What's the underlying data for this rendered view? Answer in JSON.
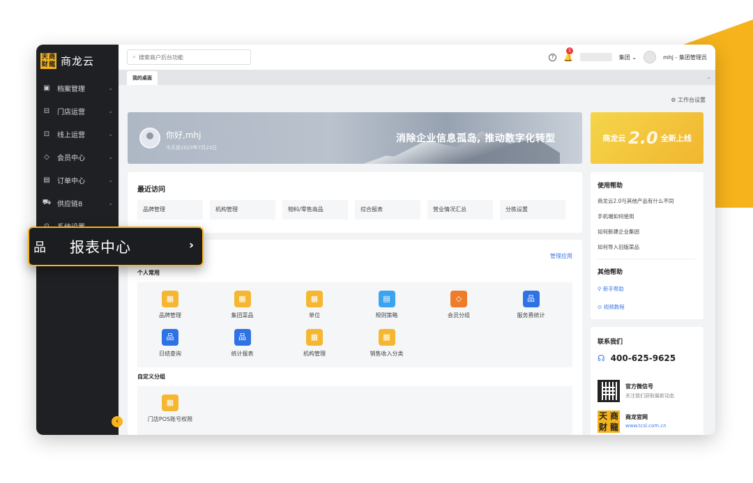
{
  "brand": {
    "logo_chars": [
      "天",
      "商",
      "财",
      "龍"
    ],
    "name": "商龙云"
  },
  "sidebar": {
    "items": [
      {
        "icon": "archive-icon",
        "glyph": "▣",
        "label": "档案管理"
      },
      {
        "icon": "store-icon",
        "glyph": "⊟",
        "label": "门店运营"
      },
      {
        "icon": "online-icon",
        "glyph": "⊡",
        "label": "线上运营"
      },
      {
        "icon": "member-icon",
        "glyph": "◇",
        "label": "会员中心"
      },
      {
        "icon": "order-icon",
        "glyph": "▤",
        "label": "订单中心"
      },
      {
        "icon": "supply-icon",
        "glyph": "⛟",
        "label": "供应链8"
      },
      {
        "icon": "settings-icon",
        "glyph": "⊙",
        "label": "系统设置"
      }
    ],
    "collapse_glyph": "‹"
  },
  "popout": {
    "label": "报表中心",
    "chevron": "›"
  },
  "topbar": {
    "search_placeholder": "搜索商户后台功能",
    "notification_count": "1",
    "group_label": "集团",
    "user_label": "mhj - 集团管理员"
  },
  "tabs": [
    {
      "label": "我的桌面"
    }
  ],
  "workspace_settings": "工作台设置",
  "banner": {
    "greeting": "你好,mhj",
    "date": "今天是2023年7月23日",
    "slogan": "消除企业信息孤岛, 推动数字化转型"
  },
  "promo": {
    "left": "商龙云",
    "big": "2.0",
    "right": "全新上线"
  },
  "recent": {
    "title": "最近访问",
    "items": [
      "品牌管理",
      "机构管理",
      "物料/零售商品",
      "综合报表",
      "营业情况汇总",
      "分拣设置"
    ]
  },
  "apps": {
    "manage_link": "管理应用",
    "personal_title": "个人常用",
    "personal": [
      {
        "label": "品牌管理",
        "color": "#f5b731",
        "glyph": "▦"
      },
      {
        "label": "集团菜品",
        "color": "#f5b731",
        "glyph": "▦"
      },
      {
        "label": "单位",
        "color": "#f5b731",
        "glyph": "▦"
      },
      {
        "label": "规则策略",
        "color": "#3ea3ee",
        "glyph": "▤"
      },
      {
        "label": "会员分组",
        "color": "#ef7c2b",
        "glyph": "◇"
      },
      {
        "label": "服务费统计",
        "color": "#2f72e4",
        "glyph": "品"
      },
      {
        "label": "日结查询",
        "color": "#2f72e4",
        "glyph": "品"
      },
      {
        "label": "统计报表",
        "color": "#2f72e4",
        "glyph": "品"
      },
      {
        "label": "机构管理",
        "color": "#f5b731",
        "glyph": "▦"
      },
      {
        "label": "销售收入分类",
        "color": "#f5b731",
        "glyph": "▦"
      }
    ],
    "custom_title": "自定义分组",
    "custom": [
      {
        "label": "门店POS账号权限",
        "color": "#f5b731",
        "glyph": "▦"
      }
    ]
  },
  "help": {
    "title": "使用帮助",
    "questions": [
      "商龙云2.0与其他产品有什么不同",
      "手机端如何使用",
      "如何新建企业集团",
      "如何导入旧版菜品"
    ],
    "other_title": "其他帮助",
    "links": [
      "新手帮助",
      "视频教程"
    ]
  },
  "contact": {
    "title": "联系我们",
    "phone": "400-625-9625",
    "wechat_title": "官方微信号",
    "wechat_sub": "关注我们获取最新动态",
    "site_title": "商龙官网",
    "site_url": "www.tcsl.com.cn"
  }
}
